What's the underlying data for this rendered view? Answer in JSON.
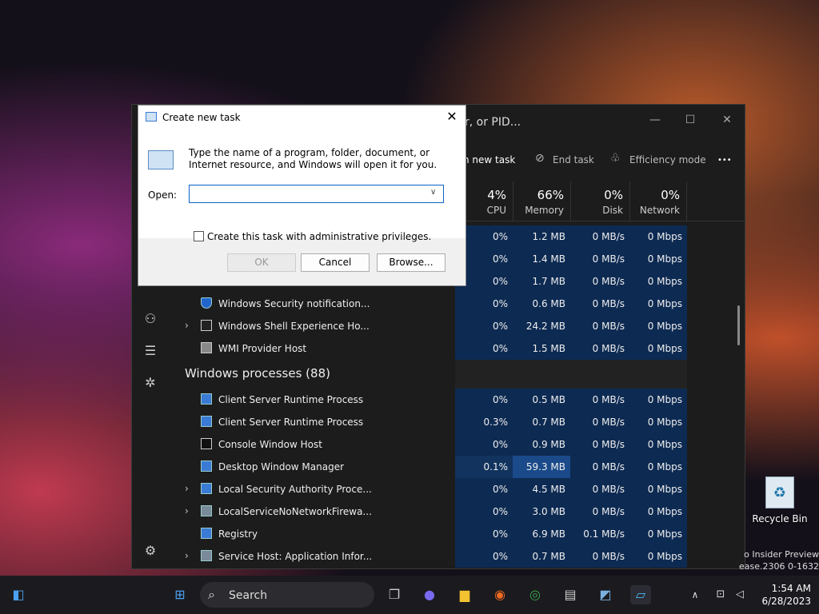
{
  "task_manager": {
    "search_text": "r, or PID...",
    "toolbar": {
      "run_new_task": "n new task",
      "end_task": "End task",
      "efficiency_mode": "Efficiency mode",
      "more": "•••"
    },
    "columns": [
      {
        "pct": "4%",
        "label": "CPU"
      },
      {
        "pct": "66%",
        "label": "Memory"
      },
      {
        "pct": "0%",
        "label": "Disk"
      },
      {
        "pct": "0%",
        "label": "Network"
      }
    ],
    "top_rows": [
      {
        "name": "",
        "cpu": "0%",
        "mem": "1.2 MB",
        "disk": "0 MB/s",
        "net": "0 Mbps"
      },
      {
        "name": "",
        "cpu": "0%",
        "mem": "1.4 MB",
        "disk": "0 MB/s",
        "net": "0 Mbps"
      },
      {
        "name": "",
        "cpu": "0%",
        "mem": "1.7 MB",
        "disk": "0 MB/s",
        "net": "0 Mbps"
      },
      {
        "name": "Windows Security notification...",
        "cpu": "0%",
        "mem": "0.6 MB",
        "disk": "0 MB/s",
        "net": "0 Mbps"
      },
      {
        "name": "Windows Shell Experience Ho...",
        "cpu": "0%",
        "mem": "24.2 MB",
        "disk": "0 MB/s",
        "net": "0 Mbps"
      },
      {
        "name": "WMI Provider Host",
        "cpu": "0%",
        "mem": "1.5 MB",
        "disk": "0 MB/s",
        "net": "0 Mbps"
      }
    ],
    "group_title": "Windows processes (88)",
    "windows_rows": [
      {
        "name": "Client Server Runtime Process",
        "cpu": "0%",
        "mem": "0.5 MB",
        "disk": "0 MB/s",
        "net": "0 Mbps"
      },
      {
        "name": "Client Server Runtime Process",
        "cpu": "0.3%",
        "mem": "0.7 MB",
        "disk": "0 MB/s",
        "net": "0 Mbps"
      },
      {
        "name": "Console Window Host",
        "cpu": "0%",
        "mem": "0.9 MB",
        "disk": "0 MB/s",
        "net": "0 Mbps"
      },
      {
        "name": "Desktop Window Manager",
        "cpu": "0.1%",
        "mem": "59.3 MB",
        "disk": "0 MB/s",
        "net": "0 Mbps"
      },
      {
        "name": "Local Security Authority Proce...",
        "cpu": "0%",
        "mem": "4.5 MB",
        "disk": "0 MB/s",
        "net": "0 Mbps"
      },
      {
        "name": "LocalServiceNoNetworkFirewa...",
        "cpu": "0%",
        "mem": "3.0 MB",
        "disk": "0 MB/s",
        "net": "0 Mbps"
      },
      {
        "name": "Registry",
        "cpu": "0%",
        "mem": "6.9 MB",
        "disk": "0.1 MB/s",
        "net": "0 Mbps"
      },
      {
        "name": "Service Host: Application Infor...",
        "cpu": "0%",
        "mem": "0.7 MB",
        "disk": "0 MB/s",
        "net": "0 Mbps"
      }
    ]
  },
  "dialog": {
    "title": "Create new task",
    "description": "Type the name of a program, folder, document, or Internet resource, and Windows will open it for you.",
    "open_label": "Open:",
    "open_value": "",
    "admin_label": "Create this task with administrative privileges.",
    "ok": "OK",
    "cancel": "Cancel",
    "browse": "Browse..."
  },
  "taskbar": {
    "search": "Search",
    "time": "1:54 AM",
    "date": "6/28/2023"
  },
  "desktop": {
    "recycle_bin": "Recycle Bin",
    "watermark_1": "o Insider Preview",
    "watermark_2": "ease.2306 0-1632"
  }
}
